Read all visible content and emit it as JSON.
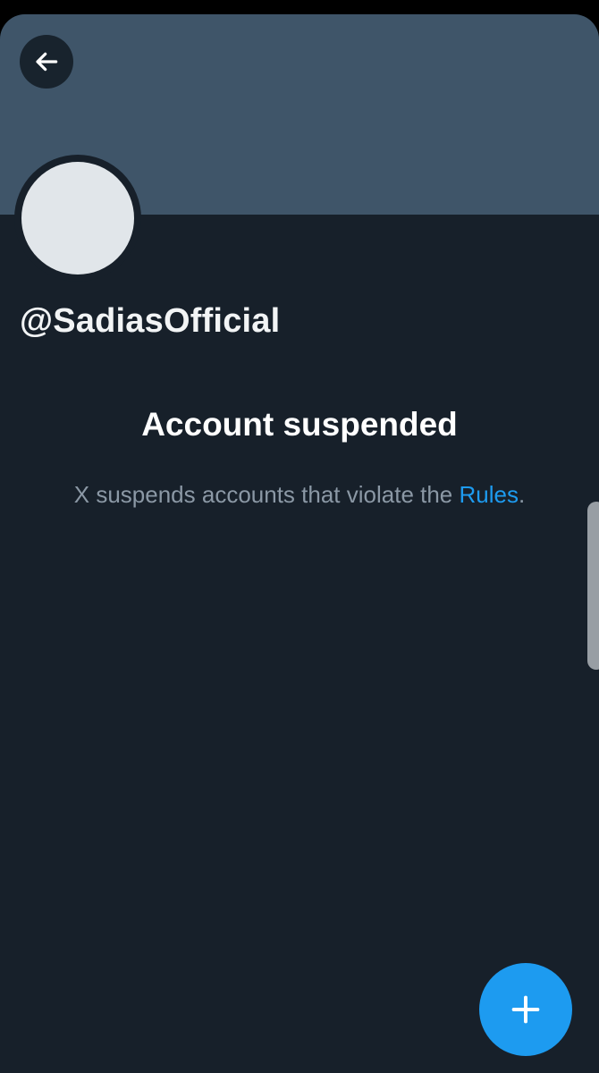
{
  "profile": {
    "handle": "@SadiasOfficial"
  },
  "suspension": {
    "title": "Account suspended",
    "message_before_link": "X suspends accounts that violate the ",
    "link_text": "Rules",
    "message_after_link": "."
  },
  "icons": {
    "back": "arrow-left-icon",
    "compose": "plus-icon"
  },
  "colors": {
    "background": "#17202a",
    "banner": "#3f5569",
    "avatar_placeholder": "#e1e6ea",
    "accent": "#1d9bf0",
    "secondary_text": "#8b98a5"
  }
}
